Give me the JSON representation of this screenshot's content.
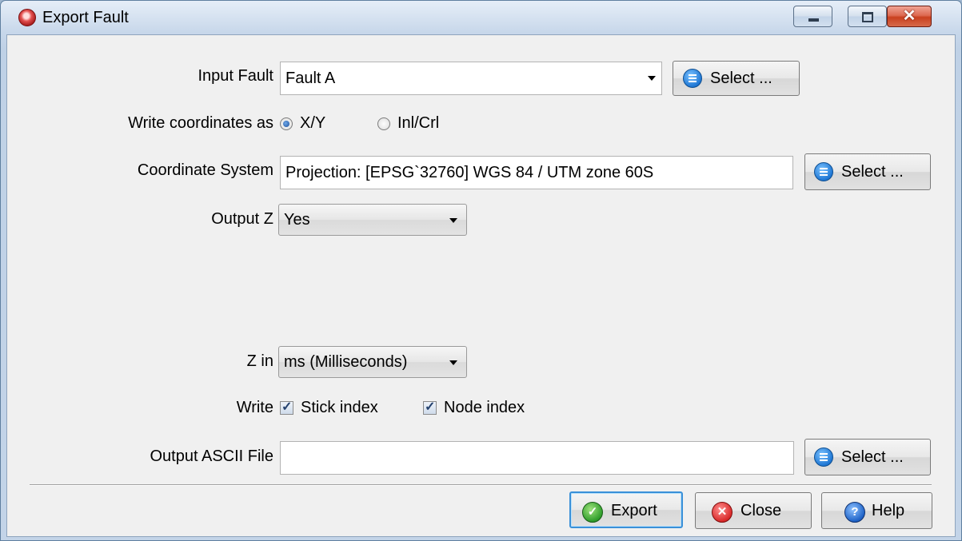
{
  "window": {
    "title": "Export Fault",
    "controls": {
      "minimize": "minimize",
      "maximize": "maximize",
      "close": "x"
    }
  },
  "form": {
    "input_fault": {
      "label": "Input Fault",
      "value": "Fault A",
      "select_label": "Select ..."
    },
    "write_coords": {
      "label": "Write coordinates as",
      "options": [
        "X/Y",
        "Inl/Crl"
      ],
      "selected": "X/Y"
    },
    "coord_system": {
      "label": "Coordinate System",
      "value": "Projection: [EPSG`32760] WGS 84 / UTM zone 60S",
      "select_label": "Select ..."
    },
    "output_z": {
      "label": "Output Z",
      "value": "Yes"
    },
    "z_in": {
      "label": "Z in",
      "value": "ms (Milliseconds)"
    },
    "write": {
      "label": "Write",
      "stick_index": "Stick index",
      "node_index": "Node index",
      "stick_checked": true,
      "node_checked": true
    },
    "output_file": {
      "label": "Output ASCII File",
      "value": "",
      "select_label": "Select ..."
    }
  },
  "footer": {
    "export": "Export",
    "close": "Close",
    "help": "Help"
  },
  "icons": {
    "app": "fault-app-icon",
    "select": "list-icon",
    "export": "check-icon",
    "close": "close-circle-icon",
    "help": "help-icon"
  }
}
